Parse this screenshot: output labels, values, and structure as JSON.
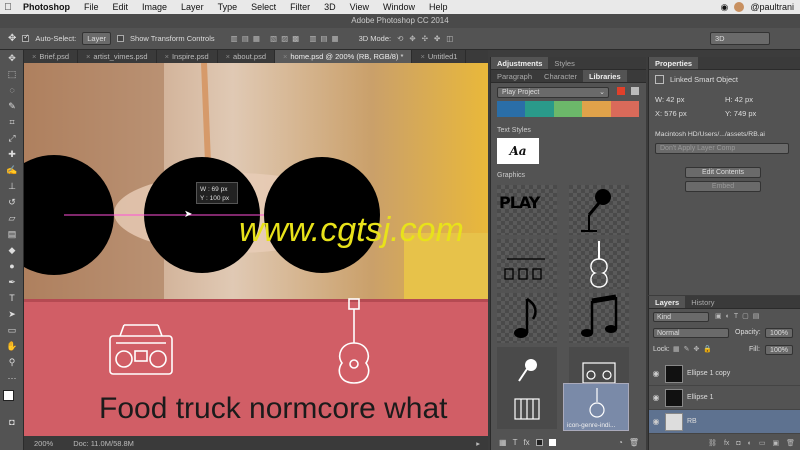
{
  "menubar": {
    "app": "Photoshop",
    "items": [
      "File",
      "Edit",
      "Image",
      "Layer",
      "Type",
      "Select",
      "Filter",
      "3D",
      "View",
      "Window",
      "Help"
    ],
    "user": "@paultrani"
  },
  "window_title": "Adobe Photoshop CC 2014",
  "options": {
    "auto_select_label": "Auto-Select:",
    "auto_select_value": "Layer",
    "transform_label": "Show Transform Controls",
    "mode_label": "3D Mode:",
    "mode_value": "3D"
  },
  "doc_tabs": [
    {
      "label": "Brief.psd",
      "active": false
    },
    {
      "label": "artist_vimes.psd",
      "active": false
    },
    {
      "label": "Inspire.psd",
      "active": false
    },
    {
      "label": "about.psd",
      "active": false
    },
    {
      "label": "home.psd @ 200% (RB, RGB/8) *",
      "active": true
    },
    {
      "label": "Untitled1",
      "active": false
    }
  ],
  "canvas": {
    "tooltip_w": "W :  69 px",
    "tooltip_h": "Y : 100 px",
    "headline": "Food truck normcore what",
    "watermark": "www.cgtsj.com",
    "band_color": "#d15e66"
  },
  "status": {
    "zoom": "200%",
    "doc": "Doc: 11.0M/58.8M"
  },
  "adj_panel": {
    "tabs": [
      "Adjustments",
      "Styles"
    ],
    "subtabs": [
      "Paragraph",
      "Character",
      "Libraries"
    ],
    "library_name": "Play Project",
    "swatches": [
      "#2a6ea8",
      "#2a9a8a",
      "#6cb86a",
      "#e0a24a",
      "#d96a5a"
    ],
    "text_styles_label": "Text Styles",
    "text_style_sample": "Aa",
    "graphics_label": "Graphics",
    "graphic_play_text": "PLAY",
    "selected_graphic_label": "icon-genre-indi..."
  },
  "properties": {
    "title": "Properties",
    "object_type": "Linked Smart Object",
    "w_label": "W:",
    "w_value": "42 px",
    "h_label": "H:",
    "h_value": "42 px",
    "x_label": "X:",
    "x_value": "576 px",
    "y_label": "Y:",
    "y_value": "749 px",
    "path": "Macintosh HD/Users/.../assets/RB.ai",
    "layer_comp": "Don't Apply Layer Comp",
    "edit_button": "Edit Contents",
    "embed_button": "Embed"
  },
  "layers": {
    "tabs": [
      "Layers",
      "History"
    ],
    "filter": "Kind",
    "blend": "Normal",
    "opacity_label": "Opacity:",
    "opacity_value": "100%",
    "lock_label": "Lock:",
    "fill_label": "Fill:",
    "fill_value": "100%",
    "rows": [
      "Ellipse 1 copy",
      "Ellipse 1",
      "RB"
    ]
  }
}
